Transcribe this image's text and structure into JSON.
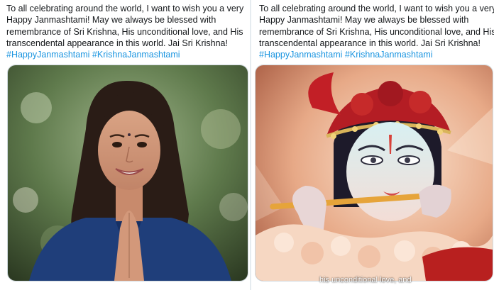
{
  "tweets": [
    {
      "lines": [
        "To all celebrating around the world, I want to wish you a very",
        "Happy Janmashtami! May we always be blessed with",
        "remembrance of Sri Krishna, His unconditional love, and His",
        "transcendental appearance in this world. Jai Sri Krishna!"
      ],
      "hashtags": [
        "#HappyJanmashtami",
        "#KrishnaJanmashtami"
      ]
    },
    {
      "lines": [
        "To all celebrating around the world, I want to wish you a very",
        "Happy Janmashtami! May we always be blessed with",
        "remembrance of Sri Krishna, His unconditional love, and His",
        "transcendental appearance in this world. Jai Sri Krishna!"
      ],
      "hashtags": [
        "#HappyJanmashtami",
        "#KrishnaJanmashtami"
      ],
      "video_caption": "his unconditional love, and"
    }
  ],
  "colors": {
    "hashtag": "#1b95e0",
    "text": "#14171a",
    "suit": "#1f3e7a",
    "hair": "#2a1c16",
    "crown_red": "#b41d24",
    "garland": "#f6d7c2"
  }
}
